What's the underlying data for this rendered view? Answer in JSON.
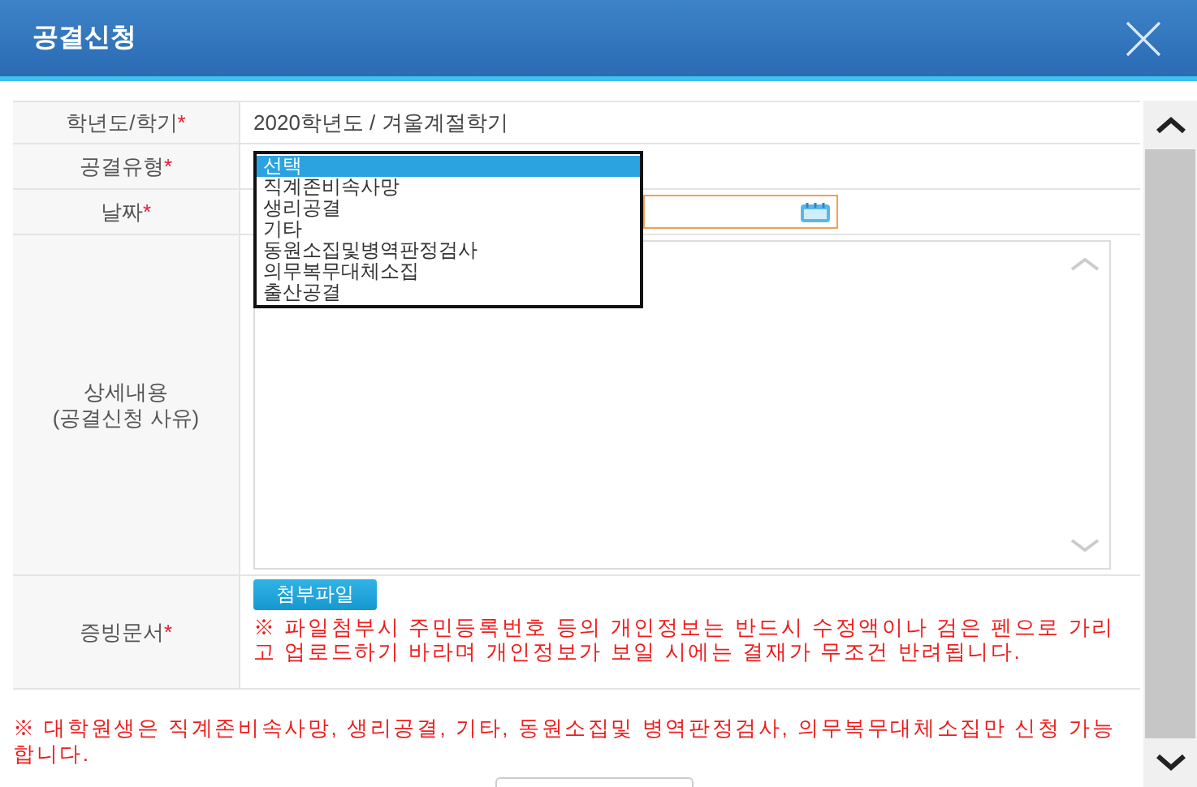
{
  "dialog": {
    "title": "공결신청"
  },
  "form": {
    "rows": [
      {
        "kind": "text",
        "label": "학년도/학기",
        "required_mark": "*",
        "value": "2020학년도 / 겨울계절학기"
      },
      {
        "kind": "select",
        "label": "공결유형",
        "required_mark": "*",
        "options": [
          {
            "label": "선택",
            "selected": true
          },
          {
            "label": "직계존비속사망",
            "selected": false
          },
          {
            "label": "생리공결",
            "selected": false
          },
          {
            "label": "기타",
            "selected": false
          },
          {
            "label": "동원소집및병역판정검사",
            "selected": false
          },
          {
            "label": "의무복무대체소집",
            "selected": false
          },
          {
            "label": "출산공결",
            "selected": false
          }
        ]
      },
      {
        "kind": "date",
        "label": "날짜",
        "required_mark": "*"
      },
      {
        "kind": "textarea",
        "label": "상세내용\n(공결신청 사유)"
      },
      {
        "kind": "file",
        "label": "증빙문서",
        "required_mark": "*",
        "button": "첨부파일",
        "notice": "※ 파일첨부시 주민등록번호 등의 개인정보는 반드시 수정액이나 검은 펜으로 가리고 업로드하기 바라며 개인정보가 보일 시에는 결재가 무조건 반려됩니다."
      }
    ]
  },
  "footer_notice": "※ 대학원생은 직계존비속사망, 생리공결, 기타, 동원소집및 병역판정검사, 의무복무대체소집만 신청 가능합니다."
}
